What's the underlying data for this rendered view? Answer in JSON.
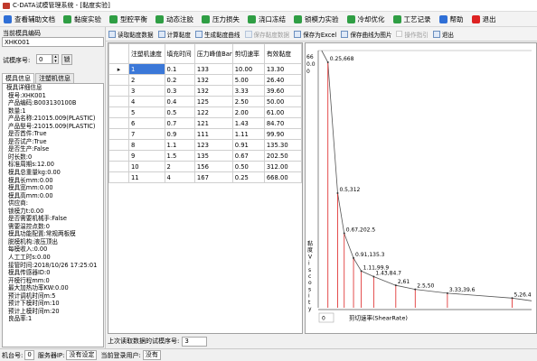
{
  "window": {
    "title": "C-DATA试模管理系统 - [黏度实验]"
  },
  "menu": [
    {
      "label": "查看辅助文档",
      "color": "#2f6fd6"
    },
    {
      "label": "黏度实验",
      "color": "#2f9e44"
    },
    {
      "label": "型腔平衡",
      "color": "#2f9e44"
    },
    {
      "label": "动态注胶",
      "color": "#2f9e44"
    },
    {
      "label": "压力损失",
      "color": "#2f9e44"
    },
    {
      "label": "浇口冻结",
      "color": "#2f9e44"
    },
    {
      "label": "锁模力实验",
      "color": "#2f9e44"
    },
    {
      "label": "冷却优化",
      "color": "#2f9e44"
    },
    {
      "label": "工艺记录",
      "color": "#2f9e44"
    },
    {
      "label": "帮助",
      "color": "#2f6fd6"
    },
    {
      "label": "退出",
      "color": "#d22"
    }
  ],
  "left": {
    "mold_code_label": "当前模具编码",
    "mold_code_value": "XHK001",
    "trial_no_label": "试模序号:",
    "trial_no_value": "0",
    "lock_label": "锁",
    "tabs": [
      "模具信息",
      "注塑机信息"
    ],
    "info_header": "模具详细信息",
    "info_lines": [
      "模号:XHK001",
      "产品编码:B003130100B",
      "数量:1",
      "产品名称:21015.009(PLASTIC)",
      "产品型号:21015.009(PLASTIC)",
      "是否首件:True",
      "是否试产:True",
      "是否生产:False",
      "时长数:0",
      "标准周期s:12.00",
      "模具总重量kg:0.00",
      "模具长mm:0.00",
      "模具宽mm:0.00",
      "模具高mm:0.00",
      "供应商:",
      "锁模力t:0.00",
      "是否需要机械手:False",
      "需要温控点数:0",
      "模具功能配置:常规两板模",
      "脱模机构:液压顶出",
      "每模收入:0.00",
      "人工工时s:0.00",
      "接管时间:2018/10/26 17:25:01",
      "模具传感器ID:0",
      "开模行程mm:0",
      "最大加热功率KW:0.00",
      "预计调机时间m:5",
      "预计下模时间m:10",
      "预计上模时间m:20",
      "良品率:1"
    ]
  },
  "toolbar": [
    {
      "label": "读取黏度数据",
      "enabled": true,
      "kind": "icon"
    },
    {
      "label": "计算黏度",
      "enabled": true,
      "kind": "icon"
    },
    {
      "label": "生成黏度曲线",
      "enabled": true,
      "kind": "icon"
    },
    {
      "label": "保存黏度数据",
      "enabled": false,
      "kind": "icon"
    },
    {
      "label": "保存为Excel",
      "enabled": true,
      "kind": "icon"
    },
    {
      "label": "保存曲线为图片",
      "enabled": true,
      "kind": "icon"
    },
    {
      "label": "操作指引",
      "enabled": false,
      "kind": "check"
    },
    {
      "label": "退出",
      "enabled": true,
      "kind": "icon"
    }
  ],
  "grid": {
    "headers": [
      "注塑机速度",
      "填充时间",
      "压力峰值Bar",
      "剪切速率",
      "有效黏度"
    ],
    "rows": [
      [
        "1",
        "0.1",
        "133",
        "10.00",
        "13.30"
      ],
      [
        "2",
        "0.2",
        "132",
        "5.00",
        "26.40"
      ],
      [
        "3",
        "0.3",
        "132",
        "3.33",
        "39.60"
      ],
      [
        "4",
        "0.4",
        "125",
        "2.50",
        "50.00"
      ],
      [
        "5",
        "0.5",
        "122",
        "2.00",
        "61.00"
      ],
      [
        "6",
        "0.7",
        "121",
        "1.43",
        "84.70"
      ],
      [
        "7",
        "0.9",
        "111",
        "1.11",
        "99.90"
      ],
      [
        "8",
        "1.1",
        "123",
        "0.91",
        "135.30"
      ],
      [
        "9",
        "1.5",
        "135",
        "0.67",
        "202.50"
      ],
      [
        "10",
        "2",
        "156",
        "0.50",
        "312.00"
      ],
      [
        "11",
        "4",
        "167",
        "0.25",
        "668.00"
      ]
    ],
    "selected_row": 0
  },
  "chart_data": {
    "type": "line",
    "xlabel": "剪切速率(ShearRate)",
    "ylabel": "黏度Viscosity",
    "x": [
      0.25,
      0.5,
      0.67,
      0.91,
      1.11,
      1.43,
      2,
      2.5,
      3.33,
      5
    ],
    "y": [
      668,
      312,
      202.5,
      135.3,
      99.9,
      84.7,
      61,
      50,
      39.6,
      26.4
    ],
    "annotations": [
      "0.25,668",
      "0.5,312",
      "0.67,202.5",
      "0.91,135.3",
      "1.11,99.9",
      "1.43,84.7",
      "2,61",
      "2.5,50",
      "3.33,39.6",
      "5,26.4"
    ],
    "y_top_ticks": [
      "66",
      "0.0",
      "0"
    ],
    "x_start_label": "0",
    "grid": false,
    "line_color": "#d22"
  },
  "status": {
    "read_label": "上次读取数据的试模序号:",
    "read_value": "3"
  },
  "bottom": {
    "machine_label": "机台号:",
    "machine_value": "0",
    "server_label": "服务器IP:",
    "server_value": "没有设定",
    "user_label": "当前登录用户:",
    "user_value": "没有"
  }
}
